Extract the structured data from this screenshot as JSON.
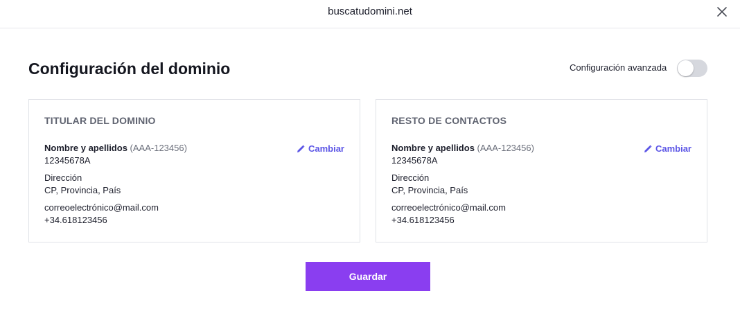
{
  "header": {
    "title": "buscatudomini.net",
    "close_icon": "close-icon"
  },
  "page": {
    "title": "Configuración del dominio",
    "advanced_label": "Configuración avanzada",
    "advanced_enabled": false
  },
  "cards": [
    {
      "title": "TITULAR DEL DOMINIO",
      "change_label": "Cambiar",
      "name_label": "Nombre y apellidos",
      "id_code": "(AAA-123456)",
      "document": "12345678A",
      "address": "Dirección",
      "location": "CP, Provincia, País",
      "email": "correoelectrónico@mail.com",
      "phone": "+34.618123456"
    },
    {
      "title": "RESTO DE CONTACTOS",
      "change_label": "Cambiar",
      "name_label": "Nombre y apellidos",
      "id_code": "(AAA-123456)",
      "document": "12345678A",
      "address": "Dirección",
      "location": "CP, Provincia, País",
      "email": "correoelectrónico@mail.com",
      "phone": "+34.618123456"
    }
  ],
  "actions": {
    "save_label": "Guardar"
  },
  "colors": {
    "accent": "#8a3ef0",
    "link": "#5b55e6",
    "toggle_off": "#d6d8de"
  }
}
